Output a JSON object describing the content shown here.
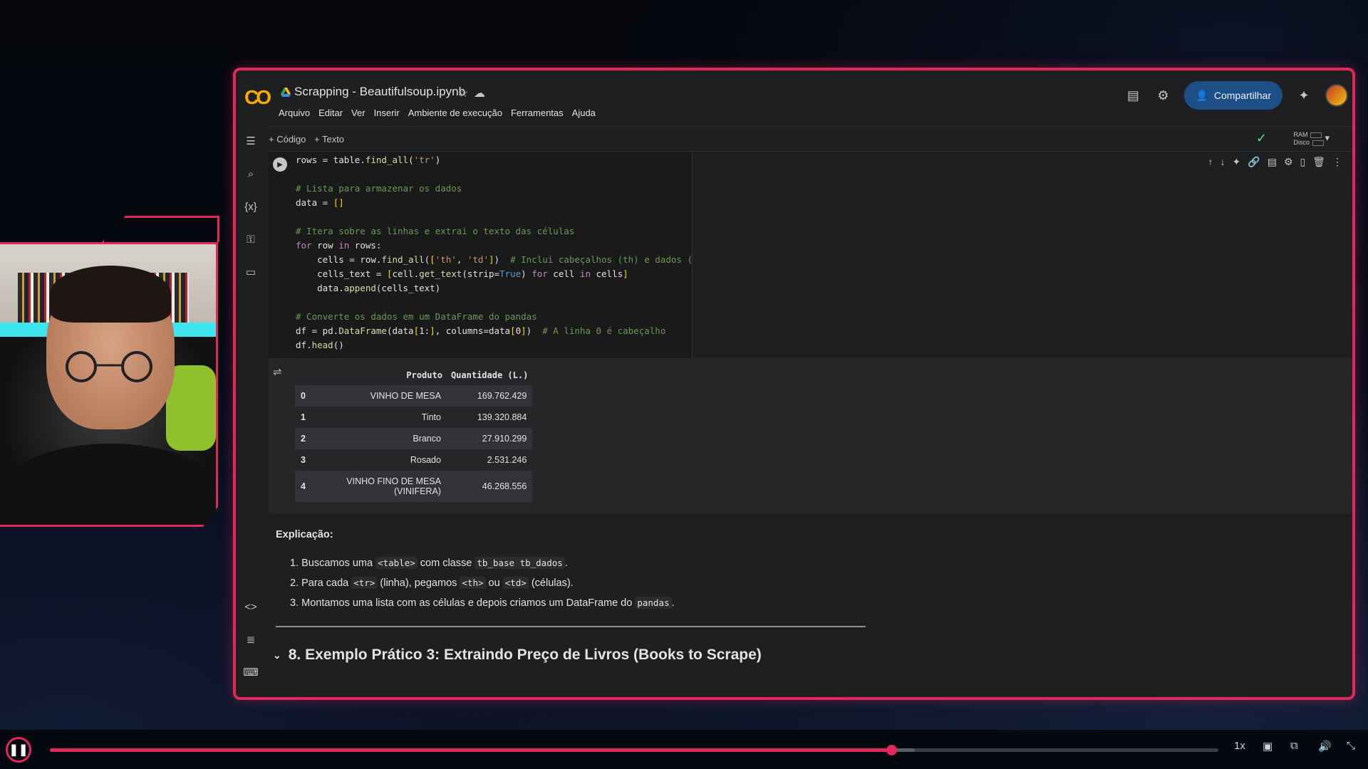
{
  "notebook": {
    "title": "Scrapping - Beautifulsoup.ipynb",
    "menu": [
      "Arquivo",
      "Editar",
      "Ver",
      "Inserir",
      "Ambiente de execução",
      "Ferramentas",
      "Ajuda"
    ],
    "share_label": "Compartilhar",
    "add_code": "+ Código",
    "add_text": "+ Texto",
    "ram_label": "RAM",
    "disk_label": "Disco"
  },
  "code_lines": [
    "rows = table.find_all('tr')",
    "",
    "# Lista para armazenar os dados",
    "data = []",
    "",
    "# Itera sobre as linhas e extrai o texto das células",
    "for row in rows:",
    "    cells = row.find_all(['th', 'td'])  # Inclui cabeçalhos (th) e dados (td)",
    "    cells_text = [cell.get_text(strip=True) for cell in cells]",
    "    data.append(cells_text)",
    "",
    "# Converte os dados em um DataFrame do pandas",
    "df = pd.DataFrame(data[1:], columns=data[0])  # A linha 0 é cabeçalho",
    "df.head()"
  ],
  "output_table": {
    "columns": [
      "Produto",
      "Quantidade (L.)"
    ],
    "rows": [
      {
        "idx": "0",
        "produto": "VINHO DE MESA",
        "quantidade": "169.762.429"
      },
      {
        "idx": "1",
        "produto": "Tinto",
        "quantidade": "139.320.884"
      },
      {
        "idx": "2",
        "produto": "Branco",
        "quantidade": "27.910.299"
      },
      {
        "idx": "3",
        "produto": "Rosado",
        "quantidade": "2.531.246"
      },
      {
        "idx": "4",
        "produto": "VINHO FINO DE MESA (VINIFERA)",
        "quantidade": "46.268.556"
      }
    ]
  },
  "explanation": {
    "title": "Explicação:",
    "item1": {
      "a": "1. Buscamos uma ",
      "c1": "<table>",
      "b": " com classe ",
      "c2": "tb_base tb_dados",
      "d": "."
    },
    "item2": {
      "a": "2. Para cada ",
      "c1": "<tr>",
      "b": " (linha), pegamos ",
      "c2": "<th>",
      "m": " ou ",
      "c3": "<td>",
      "d": " (células)."
    },
    "item3": {
      "a": "3. Montamos uma lista com as células e depois criamos um DataFrame do ",
      "c1": "pandas",
      "d": "."
    }
  },
  "section_heading": "8. Exemplo Prático 3: Extraindo Preço de Livros (Books to Scrape)",
  "player": {
    "progress": 0.72,
    "buffered": 0.74,
    "speed": "1x"
  }
}
